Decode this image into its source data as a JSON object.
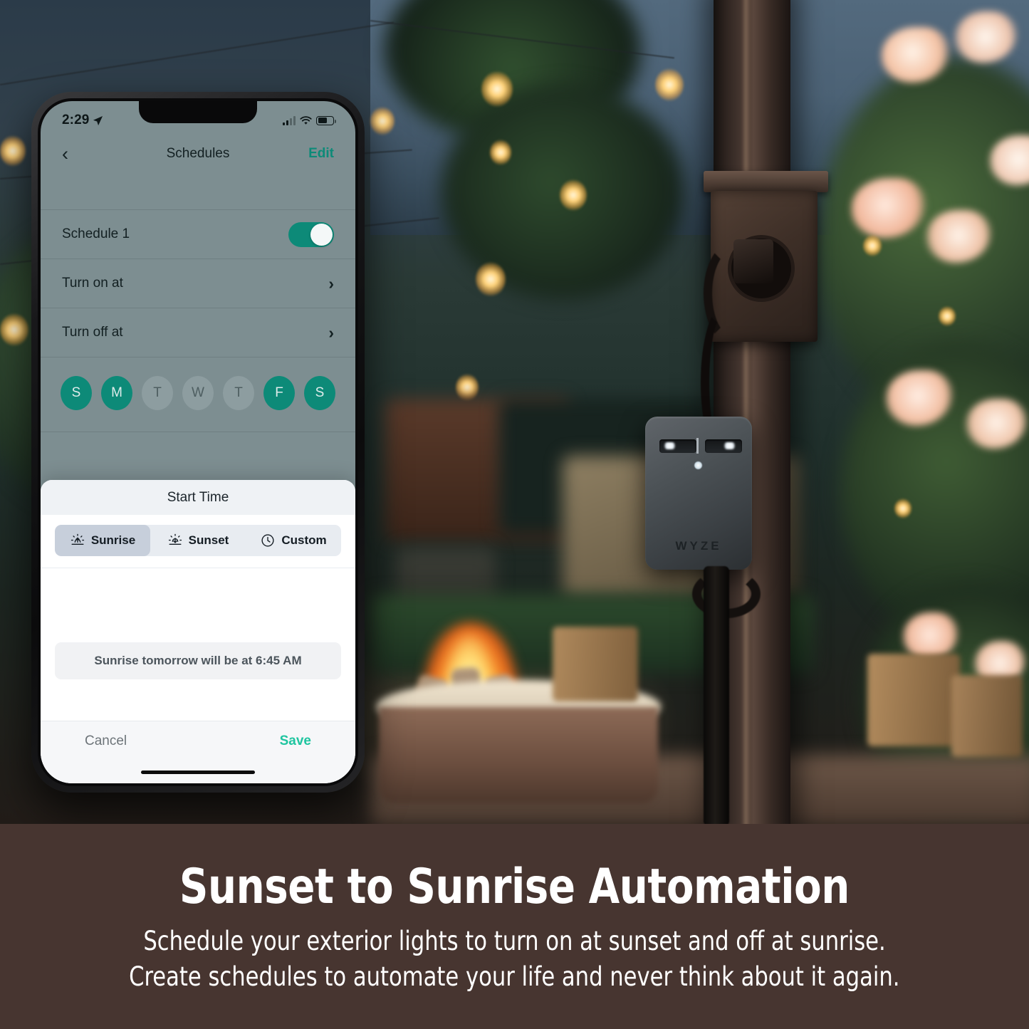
{
  "phone": {
    "status_bar": {
      "time": "2:29",
      "location_icon": "location-arrow-icon",
      "cellular_icon": "cellular-bars-icon",
      "wifi_icon": "wifi-icon",
      "battery_icon": "battery-icon"
    },
    "nav": {
      "back_icon": "back-chevron-icon",
      "title": "Schedules",
      "edit_label": "Edit"
    },
    "schedule": {
      "name": "Schedule 1",
      "toggle_state": "on",
      "rows": [
        {
          "label": "Turn on at",
          "chevron": "›"
        },
        {
          "label": "Turn off at",
          "chevron": "›"
        }
      ],
      "days": [
        {
          "letter": "S",
          "selected": true
        },
        {
          "letter": "M",
          "selected": true
        },
        {
          "letter": "T",
          "selected": false
        },
        {
          "letter": "W",
          "selected": false
        },
        {
          "letter": "T",
          "selected": false
        },
        {
          "letter": "F",
          "selected": true
        },
        {
          "letter": "S",
          "selected": true
        }
      ]
    },
    "sheet": {
      "title": "Start Time",
      "segments": [
        {
          "label": "Sunrise",
          "icon": "sunrise-icon",
          "selected": true
        },
        {
          "label": "Sunset",
          "icon": "sunset-icon",
          "selected": false
        },
        {
          "label": "Custom",
          "icon": "clock-icon",
          "selected": false
        }
      ],
      "info_text": "Sunrise tomorrow will be at 6:45 AM",
      "cancel_label": "Cancel",
      "save_label": "Save"
    }
  },
  "device": {
    "brand_logo": "WYZE"
  },
  "caption": {
    "title": "Sunset to Sunrise Automation",
    "line1": "Schedule your exterior lights to turn on at sunset and off at sunrise.",
    "line2": "Create schedules to automate your life and never think about it again."
  },
  "colors": {
    "accent_teal": "#0d8a78",
    "save_mint": "#1fc5a0",
    "caption_bg": "#473530",
    "screen_dim": "#7d8e91"
  }
}
